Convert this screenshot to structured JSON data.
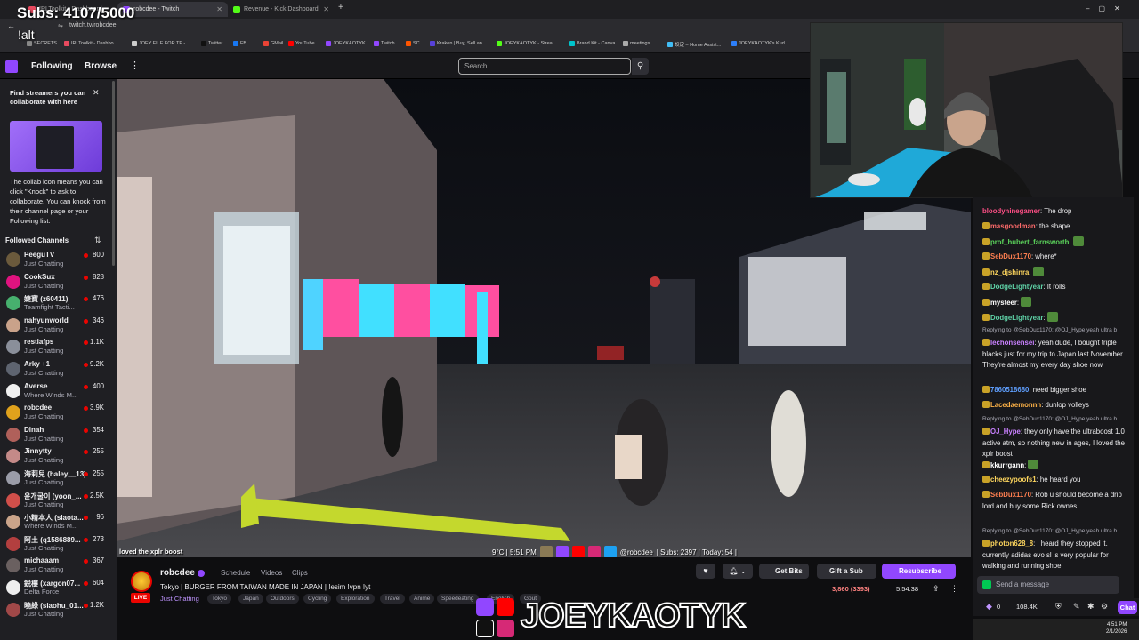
{
  "overlay": {
    "subs_goal": "Subs: 4107/5000",
    "alt": "!alt"
  },
  "browser": {
    "tabs": [
      {
        "label": "IRLToolkit - Dashboard"
      },
      {
        "label": "robcdee - Twitch"
      },
      {
        "label": "Revenue - Kick Dashboard"
      }
    ],
    "url": "twitch.tv/robcdee",
    "bookmarks": [
      "SECRETS",
      "IRLToolkit - Dashbo...",
      "JOEY FILE FOR TP -...",
      "Twitter",
      "FB",
      "GMail",
      "YouTube",
      "JOEYKAOTYK",
      "Twitch",
      "SC",
      "Kraken | Buy, Sell an...",
      "JOEYKAOTYK - Strea...",
      "Brand Kit - Canva",
      "meetings",
      "設定 – Home Assist...",
      "JOEYKAOTYK's Kud..."
    ]
  },
  "nav": {
    "following": "Following",
    "browse": "Browse",
    "search_placeholder": "Search"
  },
  "sidebar": {
    "promo_title": "Find streamers you can collaborate with here",
    "promo_text": "The collab icon means you can click \"Knock\" to ask to collaborate. You can knock from their channel page or your Following list.",
    "followed_title": "Followed Channels",
    "channels": [
      {
        "name": "PeeguTV",
        "category": "Just Chatting",
        "viewers": "800",
        "color": "#6b5a3c"
      },
      {
        "name": "CookSux",
        "category": "Just Chatting",
        "viewers": "828",
        "color": "#e0137f"
      },
      {
        "name": "婕寶 (z60411)",
        "category": "Teamfight Tacti...",
        "viewers": "476",
        "color": "#47b06e"
      },
      {
        "name": "nahyunworld",
        "category": "Just Chatting",
        "viewers": "346",
        "color": "#c9a28a"
      },
      {
        "name": "restiafps",
        "category": "Just Chatting",
        "viewers": "1.1K",
        "color": "#8a8f9a"
      },
      {
        "name": "Arky +1",
        "category": "Just Chatting",
        "viewers": "9.2K",
        "color": "#5e6470"
      },
      {
        "name": "Averse",
        "category": "Where Winds M...",
        "viewers": "400",
        "color": "#f0f0f0"
      },
      {
        "name": "robcdee",
        "category": "Just Chatting",
        "viewers": "3.9K",
        "color": "#e0a21c"
      },
      {
        "name": "Dinah",
        "category": "Just Chatting",
        "viewers": "354",
        "color": "#b0605a"
      },
      {
        "name": "Jinnytty",
        "category": "Just Chatting",
        "viewers": "255",
        "color": "#c48a88"
      },
      {
        "name": "海莉兒 (haley__13)",
        "category": "Just Chatting",
        "viewers": "255",
        "color": "#9a9ca8"
      },
      {
        "name": "윤개굴이 (yoon_...",
        "category": "Just Chatting",
        "viewers": "2.5K",
        "color": "#d04f4a"
      },
      {
        "name": "小精本人 (slaota...",
        "category": "Where Winds M...",
        "viewers": "96",
        "color": "#caa48a"
      },
      {
        "name": "阿土 (q1586889...",
        "category": "Just Chatting",
        "viewers": "273",
        "color": "#b33f3f"
      },
      {
        "name": "michaaam",
        "category": "Just Chatting",
        "viewers": "367",
        "color": "#6a6060"
      },
      {
        "name": "鋭樓 (xargon07...",
        "category": "Delta Force",
        "viewers": "604",
        "color": "#eeeeee"
      },
      {
        "name": "曉綠 (siaohu_01...",
        "category": "Just Chatting",
        "viewers": "1.2K",
        "color": "#a04848"
      }
    ]
  },
  "video": {
    "caption_left": "loved the xplr boost",
    "status_temp": "9°C | 5:51 PM",
    "status_handle": "@robcdee",
    "status_subs": "|  Subs: 2397  |  Today: 54  |"
  },
  "channel": {
    "name": "robcdee",
    "links": [
      "Schedule",
      "Videos",
      "Clips"
    ],
    "title": "Tokyo | BURGER FROM TAIWAN MADE IN JAPAN | !esim !vpn !yt",
    "category": "Just Chatting",
    "tags": [
      "Tokyo",
      "Japan",
      "Outdoors",
      "Cycling",
      "Exploration",
      "Travel",
      "Anime",
      "Speedeating",
      "English",
      "Gout"
    ],
    "live": "LIVE",
    "get_bits": "Get Bits",
    "gift_sub": "Gift a Sub",
    "resubscribe": "Resubscribe",
    "viewers": "3,860 (3393)",
    "uptime": "5:54:38"
  },
  "brand": {
    "text": "JOEYKAOTYK"
  },
  "chat": {
    "messages": [
      {
        "user": "bloodyninegamer",
        "color": "#ff4f86",
        "text": "The drop"
      },
      {
        "user": "masgoodman",
        "color": "#ff6b6b",
        "text": "the shape"
      },
      {
        "user": "prof_hubert_farnsworth",
        "color": "#5bd35b",
        "text": ""
      },
      {
        "user": "SebDux1170",
        "color": "#ff7f50",
        "text": "where*"
      },
      {
        "user": "nz_djshinra",
        "color": "#ffd75e",
        "text": ""
      },
      {
        "user": "DodgeLightyear",
        "color": "#5fd3a8",
        "text": "It rolls"
      },
      {
        "user": "mysteer",
        "color": "#ffffff",
        "text": ""
      },
      {
        "user": "DodgeLightyear",
        "color": "#5fd3a8",
        "text": ""
      },
      {
        "reply": "Replying to @SebDux1170: @OJ_Hype yeah ultra b",
        "user": "lechonsensei",
        "color": "#c980ff",
        "text": "yeah dude, I bought triple blacks just for my trip to Japan last November. They're almost my every day shoe now"
      },
      {
        "user": "7860518680",
        "color": "#5f9fff",
        "text": "need bigger shoe"
      },
      {
        "user": "Lacedaemonnn",
        "color": "#ffb347",
        "text": "dunlop volleys"
      },
      {
        "reply": "Replying to @SebDux1170: @OJ_Hype yeah ultra b",
        "user": "OJ_Hype",
        "color": "#c980ff",
        "text": "they only have the ultraboost 1.0 active atm, so nothing new in ages, I loved the xplr boost"
      },
      {
        "user": "kkurrgann",
        "color": "#ffffff",
        "text": ""
      },
      {
        "user": "cheezypoofs1",
        "color": "#ffd75e",
        "text": "he heard you"
      },
      {
        "user": "SebDux1170",
        "color": "#ff7f50",
        "text": "Rob u should become a drip lord and buy some Rick ownes"
      },
      {
        "reply": "Replying to @SebDux1170: @OJ_Hype yeah ultra b",
        "user": "photon628_8",
        "color": "#ffd75e",
        "text": "I heard they stopped it. currently adidas evo sl is very popular for walking and running shoe"
      }
    ],
    "input_placeholder": "Send a message",
    "points_a": "0",
    "points_b": "108.4K",
    "chat_button": "Chat"
  },
  "taskbar": {
    "time": "4:51 PM",
    "date": "2/1/2026"
  }
}
